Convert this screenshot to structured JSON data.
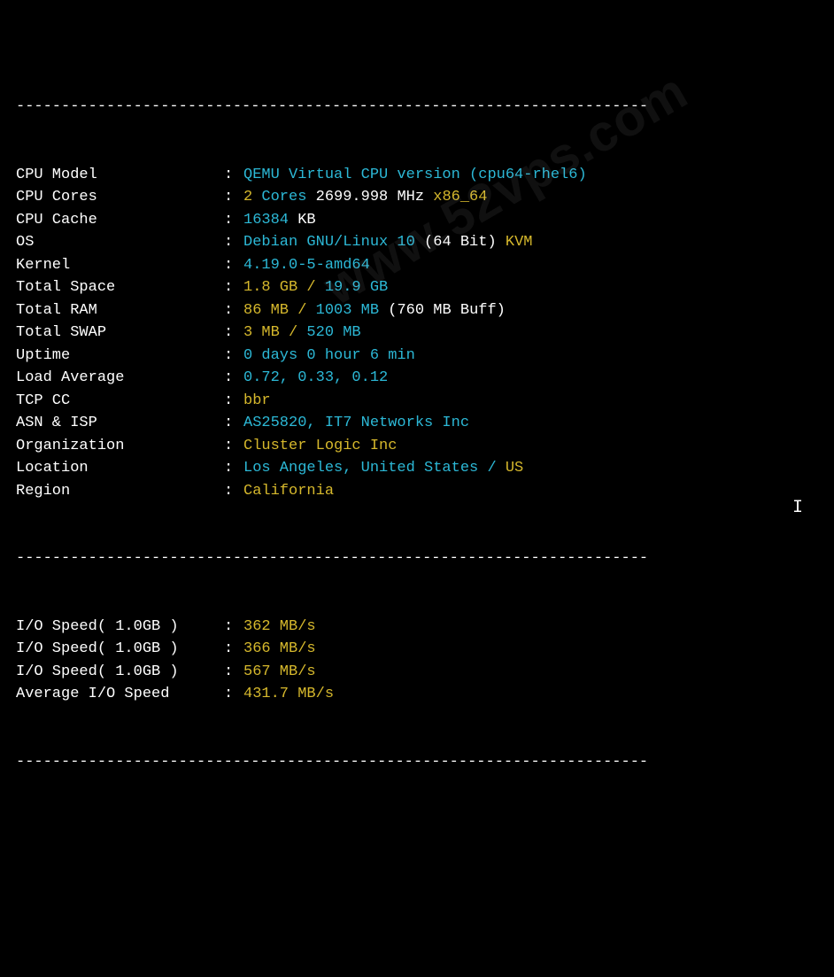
{
  "divider": "----------------------------------------------------------------------",
  "watermark": "www.52vps.com",
  "sysinfo": [
    {
      "label": "CPU Model",
      "parts": [
        {
          "cls": "cyan",
          "text": "QEMU Virtual CPU version (cpu64-rhel6)"
        }
      ]
    },
    {
      "label": "CPU Cores",
      "parts": [
        {
          "cls": "yellow",
          "text": "2"
        },
        {
          "cls": "cyan",
          "text": " Cores "
        },
        {
          "cls": "white",
          "text": "2699.998 MHz "
        },
        {
          "cls": "yellow",
          "text": "x86_64"
        }
      ]
    },
    {
      "label": "CPU Cache",
      "parts": [
        {
          "cls": "cyan",
          "text": "16384 "
        },
        {
          "cls": "white",
          "text": "KB"
        }
      ]
    },
    {
      "label": "OS",
      "parts": [
        {
          "cls": "cyan",
          "text": "Debian GNU/Linux 10 "
        },
        {
          "cls": "white",
          "text": "(64 Bit) "
        },
        {
          "cls": "yellow",
          "text": "KVM"
        }
      ]
    },
    {
      "label": "Kernel",
      "parts": [
        {
          "cls": "cyan",
          "text": "4.19.0-5-amd64"
        }
      ]
    },
    {
      "label": "Total Space",
      "parts": [
        {
          "cls": "yellow",
          "text": "1.8 GB / "
        },
        {
          "cls": "cyan",
          "text": "19.9 GB"
        }
      ]
    },
    {
      "label": "Total RAM",
      "parts": [
        {
          "cls": "yellow",
          "text": "86 MB / "
        },
        {
          "cls": "cyan",
          "text": "1003 MB "
        },
        {
          "cls": "white",
          "text": "(760 MB Buff)"
        }
      ]
    },
    {
      "label": "Total SWAP",
      "parts": [
        {
          "cls": "yellow",
          "text": "3 MB / "
        },
        {
          "cls": "cyan",
          "text": "520 MB"
        }
      ]
    },
    {
      "label": "Uptime",
      "parts": [
        {
          "cls": "cyan",
          "text": "0 days 0 hour 6 min"
        }
      ]
    },
    {
      "label": "Load Average",
      "parts": [
        {
          "cls": "cyan",
          "text": "0.72, 0.33, 0.12"
        }
      ]
    },
    {
      "label": "TCP CC",
      "parts": [
        {
          "cls": "yellow",
          "text": "bbr"
        }
      ]
    },
    {
      "label": "ASN & ISP",
      "parts": [
        {
          "cls": "cyan",
          "text": "AS25820, IT7 Networks Inc"
        }
      ]
    },
    {
      "label": "Organization",
      "parts": [
        {
          "cls": "yellow",
          "text": "Cluster Logic Inc"
        }
      ]
    },
    {
      "label": "Location",
      "parts": [
        {
          "cls": "cyan",
          "text": "Los Angeles, United States / "
        },
        {
          "cls": "yellow",
          "text": "US"
        }
      ]
    },
    {
      "label": "Region",
      "parts": [
        {
          "cls": "yellow",
          "text": "California"
        }
      ]
    }
  ],
  "iospeed": [
    {
      "label": "I/O Speed( 1.0GB )",
      "parts": [
        {
          "cls": "yellow",
          "text": "362 MB/s"
        }
      ]
    },
    {
      "label": "I/O Speed( 1.0GB )",
      "parts": [
        {
          "cls": "yellow",
          "text": "366 MB/s"
        }
      ]
    },
    {
      "label": "I/O Speed( 1.0GB )",
      "parts": [
        {
          "cls": "yellow",
          "text": "567 MB/s"
        }
      ]
    },
    {
      "label": "Average I/O Speed",
      "parts": [
        {
          "cls": "yellow",
          "text": "431.7 MB/s"
        }
      ]
    }
  ],
  "cursor": "I"
}
